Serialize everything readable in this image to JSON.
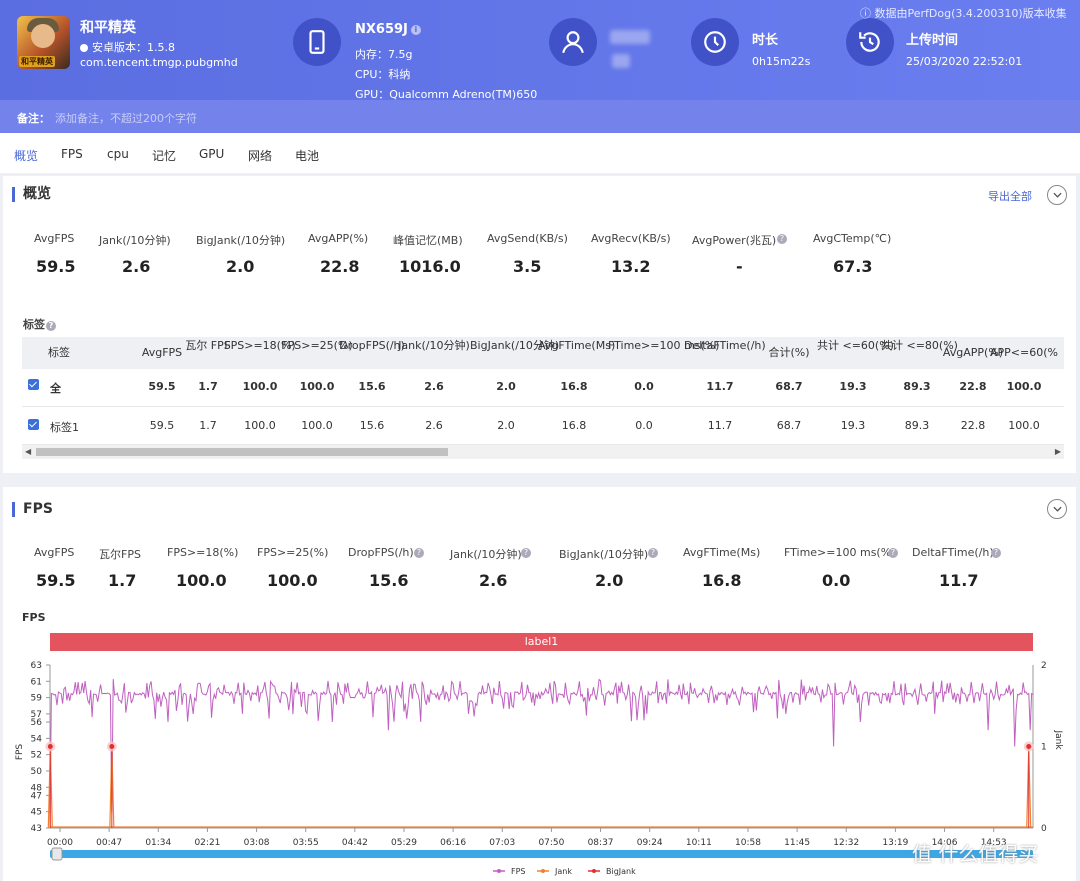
{
  "app": {
    "name": "和平精英",
    "version": "安卓版本：1.5.8",
    "package": "com.tencent.tmgp.pubgmhd",
    "icon_badge": "和平精英"
  },
  "device": {
    "model": "NX659J",
    "memory": "内存：7.5g",
    "cpu": "CPU：科纳",
    "gpu": "GPU：Qualcomm Adreno(TM)650"
  },
  "duration": {
    "title": "时长",
    "value": "0h15m22s"
  },
  "upload": {
    "title": "上传时间",
    "value": "25/03/2020 22:52:01"
  },
  "source_note": "数据由PerfDog(3.4.200310)版本收集",
  "remark": {
    "label": "备注：",
    "placeholder": "添加备注，不超过200个字符"
  },
  "tabs": [
    "概览",
    "FPS",
    "cpu",
    "记忆",
    "GPU",
    "网络",
    "电池"
  ],
  "overview": {
    "title": "概览",
    "export_label": "导出全部",
    "stats": [
      {
        "label": "AvgFPS",
        "value": "59.5"
      },
      {
        "label": "Jank(/10分钟)",
        "value": "2.6"
      },
      {
        "label": "BigJank(/10分钟)",
        "value": "2.0"
      },
      {
        "label": "AvgAPP(%)",
        "value": "22.8"
      },
      {
        "label": "峰值记忆(MB)",
        "value": "1016.0"
      },
      {
        "label": "AvgSend(KB/s)",
        "value": "3.5"
      },
      {
        "label": "AvgRecv(KB/s)",
        "value": "13.2"
      },
      {
        "label": "AvgPower(兆瓦)",
        "value": "-"
      },
      {
        "label": "AvgCTemp(℃)",
        "value": "67.3"
      }
    ],
    "tags_label": "标签",
    "table": {
      "headers": [
        "标签",
        "AvgFPS",
        "瓦尔 FPS",
        "FPS>=18(%)",
        "FPS>=25(%)",
        "DropFPS(/h)",
        "Jank(/10分钟)",
        "BigJank(/10分钟)",
        "AvgFTime(Ms)",
        "FTime>=100 ms(%)",
        "DeltaFTime(/h)",
        "合计(%)",
        "共计 <=60(%)",
        "共计 <=80(%)",
        "AvgAPP(%)",
        "APP<=60(%"
      ],
      "rows": [
        {
          "cells": [
            "全",
            "59.5",
            "1.7",
            "100.0",
            "100.0",
            "15.6",
            "2.6",
            "2.0",
            "16.8",
            "0.0",
            "11.7",
            "68.7",
            "19.3",
            "89.3",
            "22.8",
            "100.0"
          ]
        },
        {
          "cells": [
            "标签1",
            "59.5",
            "1.7",
            "100.0",
            "100.0",
            "15.6",
            "2.6",
            "2.0",
            "16.8",
            "0.0",
            "11.7",
            "68.7",
            "19.3",
            "89.3",
            "22.8",
            "100.0"
          ]
        }
      ]
    }
  },
  "fps_section": {
    "title": "FPS",
    "stats": [
      {
        "label": "AvgFPS",
        "value": "59.5"
      },
      {
        "label": "瓦尔FPS",
        "value": "1.7"
      },
      {
        "label": "FPS>=18(%)",
        "value": "100.0"
      },
      {
        "label": "FPS>=25(%)",
        "value": "100.0"
      },
      {
        "label": "DropFPS(/h)",
        "value": "15.6"
      },
      {
        "label": "Jank(/10分钟)",
        "value": "2.6"
      },
      {
        "label": "BigJank(/10分钟)",
        "value": "2.0"
      },
      {
        "label": "AvgFTime(Ms)",
        "value": "16.8"
      },
      {
        "label": "FTime>=100 ms(%)",
        "value": "0.0"
      },
      {
        "label": "DeltaFTime(/h)",
        "value": "11.7"
      }
    ],
    "chart_label": "FPS",
    "label_bar": "label1"
  },
  "watermark": "值 什么值得买",
  "chart_data": {
    "type": "line",
    "title": "FPS",
    "ylabel": "FPS",
    "y2label": "Jank",
    "ylim": [
      43,
      63
    ],
    "y2lim": [
      0,
      2
    ],
    "yticks": [
      63,
      61,
      59,
      57,
      56,
      54,
      52,
      50,
      48,
      47,
      45,
      43
    ],
    "y2ticks": [
      2,
      1,
      0
    ],
    "xticks": [
      "00:00",
      "00:47",
      "01:34",
      "02:21",
      "03:08",
      "03:55",
      "04:42",
      "05:29",
      "06:16",
      "07:03",
      "07:50",
      "08:37",
      "09:24",
      "10:11",
      "10:58",
      "11:45",
      "12:32",
      "13:19",
      "14:06",
      "14:53"
    ],
    "legend": [
      "FPS",
      "Jank",
      "BigJank"
    ],
    "legend_position": "bottom",
    "series": [
      {
        "name": "FPS",
        "color": "#c060c0",
        "baseline": 59.5,
        "dips": [
          {
            "t": 0.3,
            "v": 44
          },
          {
            "t": 58,
            "v": 45
          },
          {
            "t": 110,
            "v": 56
          },
          {
            "t": 135,
            "v": 57
          },
          {
            "t": 180,
            "v": 57
          },
          {
            "t": 265,
            "v": 56
          },
          {
            "t": 318,
            "v": 55
          },
          {
            "t": 392,
            "v": 57
          },
          {
            "t": 455,
            "v": 58
          },
          {
            "t": 560,
            "v": 57
          },
          {
            "t": 690,
            "v": 57
          },
          {
            "t": 735,
            "v": 53
          },
          {
            "t": 760,
            "v": 56
          },
          {
            "t": 830,
            "v": 57
          },
          {
            "t": 880,
            "v": 55
          },
          {
            "t": 905,
            "v": 53
          },
          {
            "t": 920,
            "v": 55
          },
          {
            "t": 935,
            "v": 56
          },
          {
            "t": 950,
            "v": 55
          }
        ]
      },
      {
        "name": "Jank",
        "color": "#f08030",
        "points": [
          [
            0.3,
            1
          ],
          [
            58,
            1
          ],
          [
            918,
            1
          ]
        ]
      },
      {
        "name": "BigJank",
        "color": "#e03030",
        "points": [
          [
            0.3,
            1
          ],
          [
            58,
            1
          ],
          [
            918,
            1
          ]
        ]
      }
    ],
    "x_range_seconds": [
      0,
      922
    ]
  }
}
